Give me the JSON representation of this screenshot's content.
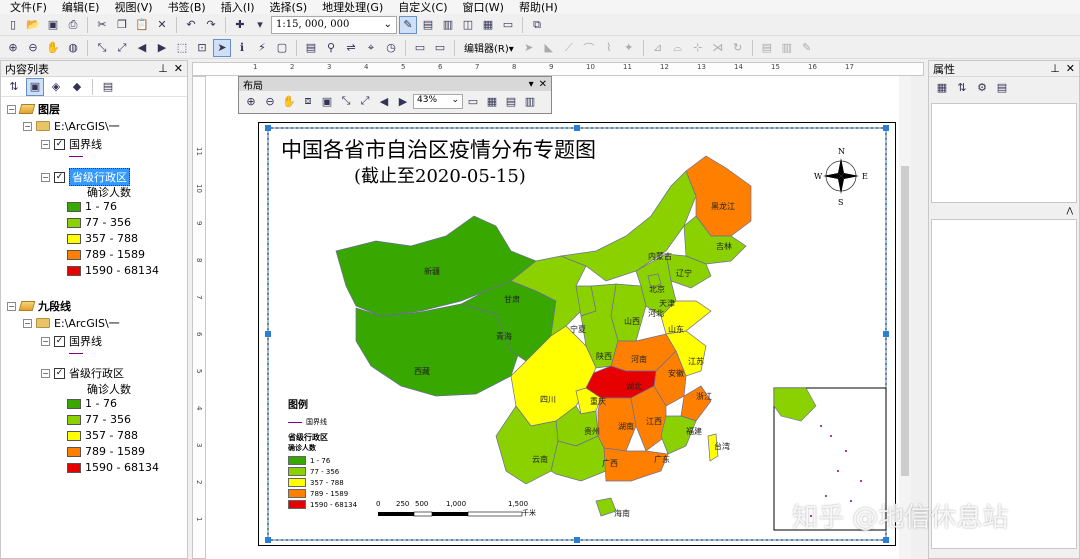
{
  "menu": [
    "文件(F)",
    "编辑(E)",
    "视图(V)",
    "书签(B)",
    "插入(I)",
    "选择(S)",
    "地理处理(G)",
    "自定义(C)",
    "窗口(W)",
    "帮助(H)"
  ],
  "toolbar": {
    "scale": "1:15, 000, 000",
    "editor_label": "编辑器(R)▾"
  },
  "toc": {
    "title": "内容列表",
    "groups": [
      {
        "name": "图层",
        "folder": "E:\\ArcGIS\\一",
        "layer1": "国界线",
        "layer2": "省级行政区",
        "field": "确诊人数",
        "classes": [
          "1 - 76",
          "77 - 356",
          "357 - 788",
          "789 - 1589",
          "1590 - 68134"
        ]
      },
      {
        "name": "九段线",
        "folder": "E:\\ArcGIS\\一",
        "layer1": "国界线",
        "layer2": "省级行政区",
        "field": "确诊人数",
        "classes": [
          "1 - 76",
          "77 - 356",
          "357 - 788",
          "789 - 1589",
          "1590 - 68134"
        ]
      }
    ],
    "class_colors": [
      "#38a800",
      "#8bd100",
      "#ffff00",
      "#ff8000",
      "#e60000"
    ]
  },
  "layout_toolbar": {
    "title": "布局",
    "zoom": "43%"
  },
  "properties": {
    "title": "属性"
  },
  "map": {
    "title": "中国各省市自治区疫情分布专题图",
    "subtitle": "(截止至2020-05-15)",
    "provinces": [
      "新疆",
      "西藏",
      "青海",
      "甘肃",
      "内蒙古",
      "黑龙江",
      "吉林",
      "辽宁",
      "北京",
      "天津",
      "河北",
      "宁夏",
      "山西",
      "山东",
      "陕西",
      "河南",
      "江苏",
      "安徽",
      "湖北",
      "四川",
      "重庆",
      "浙江",
      "贵州",
      "湖南",
      "江西",
      "福建",
      "云南",
      "广西",
      "广东",
      "海南",
      "台湾"
    ],
    "compass": {
      "n": "N",
      "s": "S",
      "w": "W",
      "e": "E"
    },
    "legend": {
      "title": "图例",
      "line": "国界线",
      "layer": "省级行政区",
      "field": "确诊人数",
      "classes": [
        "1 - 76",
        "77 - 356",
        "357 - 788",
        "789 - 1589",
        "1590 - 68134"
      ]
    },
    "scalebar": {
      "ticks": [
        "0",
        "250",
        "500",
        "1,000",
        "1,500"
      ],
      "unit": "千米"
    },
    "watermark": "知乎 @地信休息站"
  },
  "ruler_ticks": [
    "1",
    "2",
    "3",
    "4",
    "5",
    "6",
    "7",
    "8",
    "9",
    "10",
    "11",
    "12",
    "13",
    "14",
    "15",
    "16",
    "17"
  ],
  "vruler_ticks": [
    "11",
    "10",
    "9",
    "8",
    "7",
    "6",
    "5",
    "4",
    "3",
    "2",
    "1"
  ]
}
